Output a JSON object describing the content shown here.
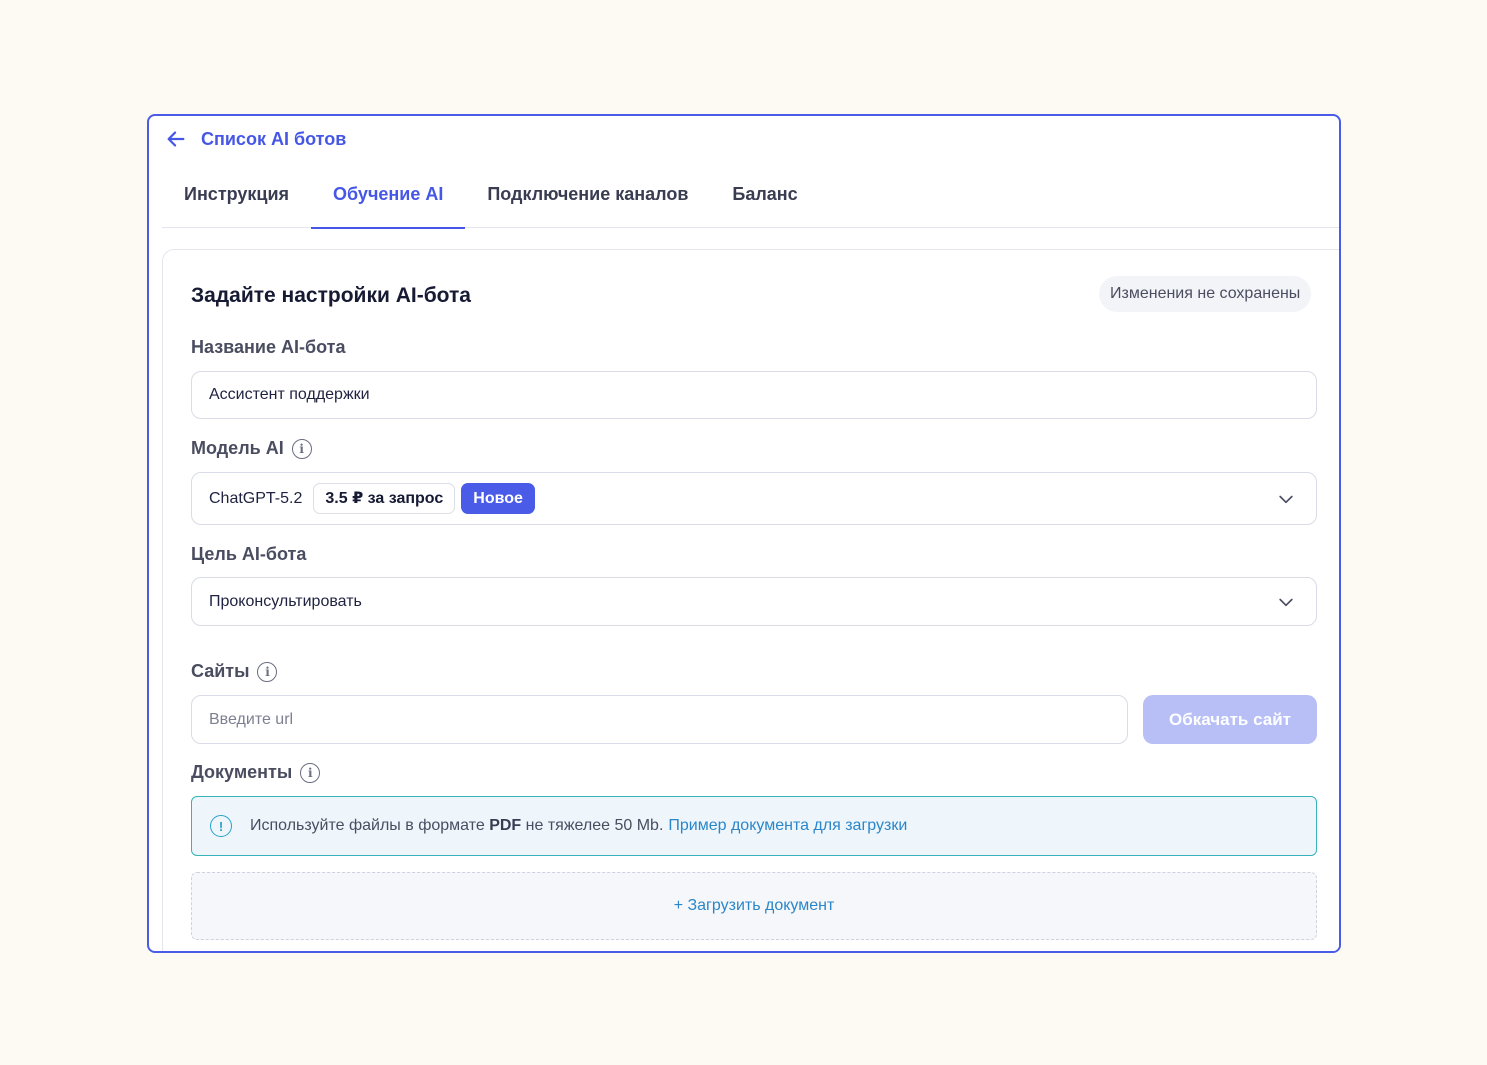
{
  "back": {
    "label": "Список AI ботов"
  },
  "tabs": [
    {
      "label": "Инструкция"
    },
    {
      "label": "Обучение AI"
    },
    {
      "label": "Подключение каналов"
    },
    {
      "label": "Баланс"
    }
  ],
  "active_tab": "Обучение AI",
  "card": {
    "title": "Задайте настройки AI-бота",
    "save_status": "Изменения не сохранены"
  },
  "bot_name": {
    "label": "Название AI-бота",
    "value": "Ассистент поддержки"
  },
  "model": {
    "label": "Модель AI",
    "selected": "ChatGPT-5.2",
    "price": "3.5 ₽ за запрос",
    "badge": "Новое"
  },
  "goal": {
    "label": "Цель AI-бота",
    "selected": "Проконсультировать"
  },
  "sites": {
    "label": "Сайты",
    "placeholder": "Введите url",
    "button": "Обкачать сайт"
  },
  "documents": {
    "label": "Документы",
    "notice_prefix": "Используйте файлы в формате",
    "notice_format": "PDF",
    "notice_suffix": "не тяжелее 50 Mb.",
    "notice_link": "Пример документа для загрузки",
    "upload_label": "+ Загрузить документ"
  },
  "colors": {
    "accent": "#4a5be8",
    "accent_disabled": "#b7bff6",
    "link": "#2b86c9",
    "notice_border": "#35b3b8",
    "background": "#fdf9f3"
  },
  "icons": [
    "arrow-left-icon",
    "info-icon",
    "chevron-down-icon",
    "alert-circle-icon"
  ]
}
